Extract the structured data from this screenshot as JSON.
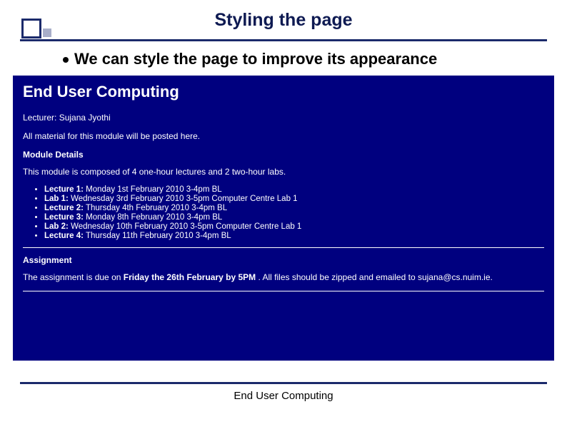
{
  "slide": {
    "title": "Styling the page",
    "bullet": "We can style the page to improve its appearance",
    "footer": "End User Computing"
  },
  "preview": {
    "heading": "End User Computing",
    "lecturer": "Lecturer: Sujana Jyothi",
    "material": "All material for this module will be posted here.",
    "module_details_label": "Module Details",
    "module_composition": "This module is composed of 4 one-hour lectures and 2 two-hour labs.",
    "schedule": [
      {
        "label": "Lecture 1:",
        "text": " Monday 1st February 2010 3-4pm BL"
      },
      {
        "label": "Lab 1:",
        "text": " Wednesday 3rd February 2010 3-5pm Computer Centre Lab 1"
      },
      {
        "label": "Lecture 2:",
        "text": " Thursday 4th February 2010 3-4pm BL"
      },
      {
        "label": "Lecture 3:",
        "text": " Monday 8th February 2010 3-4pm BL"
      },
      {
        "label": "Lab 2:",
        "text": " Wednesday 10th February 2010 3-5pm Computer Centre Lab 1"
      },
      {
        "label": "Lecture 4:",
        "text": " Thursday 11th February 2010 3-4pm BL"
      }
    ],
    "assignment_label": "Assignment",
    "assignment_prefix": "The assignment is due on ",
    "assignment_bold": "Friday the 26th February by 5PM",
    "assignment_suffix": " . All files should be zipped and emailed to sujana@cs.nuim.ie."
  }
}
